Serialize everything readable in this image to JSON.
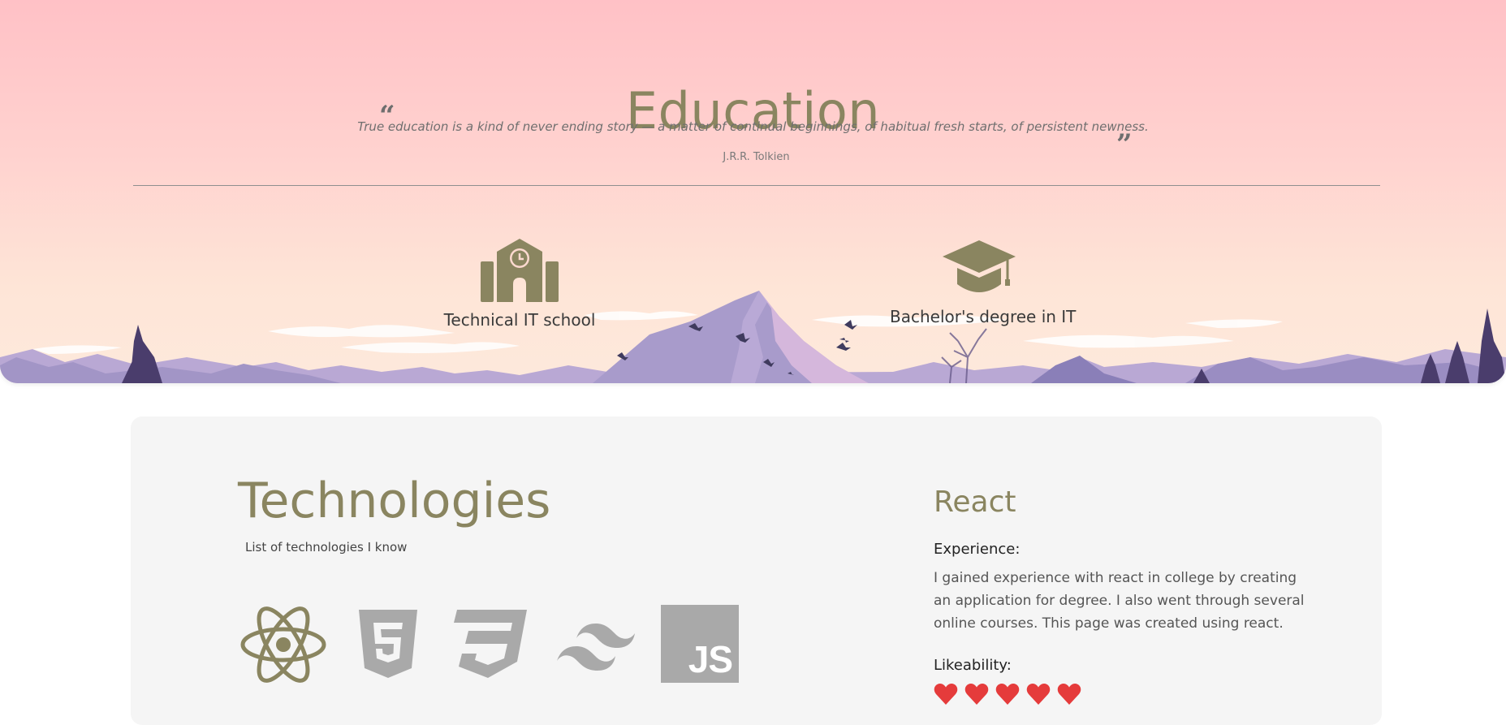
{
  "education": {
    "title": "Education",
    "quote": "True education is a kind of never ending story — a matter of continual beginnings, of habitual fresh starts, of persistent newness.",
    "quote_author": "J.R.R. Tolkien",
    "quote_open": "“",
    "quote_close": "”",
    "items": [
      {
        "label": "Technical IT school",
        "icon": "school-icon"
      },
      {
        "label": "Bachelor's degree in IT",
        "icon": "graduation-cap-icon"
      }
    ]
  },
  "technologies": {
    "title": "Technologies",
    "subtitle": "List of technologies I know",
    "icons": [
      "react-icon",
      "html5-icon",
      "css3-icon",
      "tailwind-icon",
      "javascript-icon"
    ],
    "js_label": "JS",
    "html_label": "5",
    "selected": {
      "name": "React",
      "experience_label": "Experience:",
      "experience_text": "I gained experience with react in college by creating an application for degree. I also went through several online courses. This page was created using react.",
      "likeability_label": "Likeability:",
      "likeability": 5
    }
  },
  "colors": {
    "accent": "#8a8560",
    "heart": "#e53b3b",
    "tech_icon_gray": "#a9a9a9"
  }
}
